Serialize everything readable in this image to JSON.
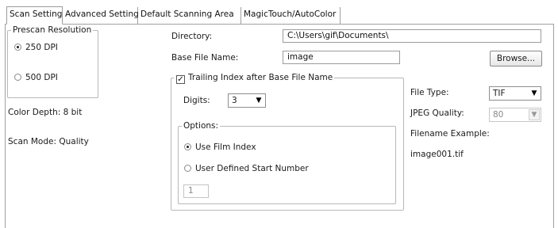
{
  "tabs": [
    {
      "label": "Scan Setting",
      "active": true
    },
    {
      "label": "Advanced Setting",
      "active": false
    },
    {
      "label": "Default Scanning Area",
      "active": false
    },
    {
      "label": "MagicTouch/AutoColor",
      "active": false
    }
  ],
  "prescan": {
    "legend": "Prescan Resolution",
    "options": [
      {
        "label": "250 DPI",
        "selected": true
      },
      {
        "label": "500 DPI",
        "selected": false
      }
    ]
  },
  "info": {
    "color_depth": "Color Depth: 8 bit",
    "scan_mode": "Scan Mode: Quality"
  },
  "directory": {
    "label": "Directory:",
    "value": "C:\\Users\\gif\\Documents\\"
  },
  "base_file_name": {
    "label": "Base File Name:",
    "value": "image"
  },
  "browse_label": "Browse...",
  "trailing_index": {
    "label": "Trailing Index after Base File Name",
    "checked": true,
    "digits_label": "Digits:",
    "digits_value": "3",
    "options_legend": "Options:",
    "use_film_index": "Use Film Index",
    "user_defined": "User Defined Start Number",
    "start_number": "1"
  },
  "file_type": {
    "label": "File Type:",
    "value": "TIF"
  },
  "jpeg_quality": {
    "label": "JPEG Quality:",
    "value": "80"
  },
  "filename_example": {
    "label": "Filename Example:",
    "value": "image001.tif"
  }
}
